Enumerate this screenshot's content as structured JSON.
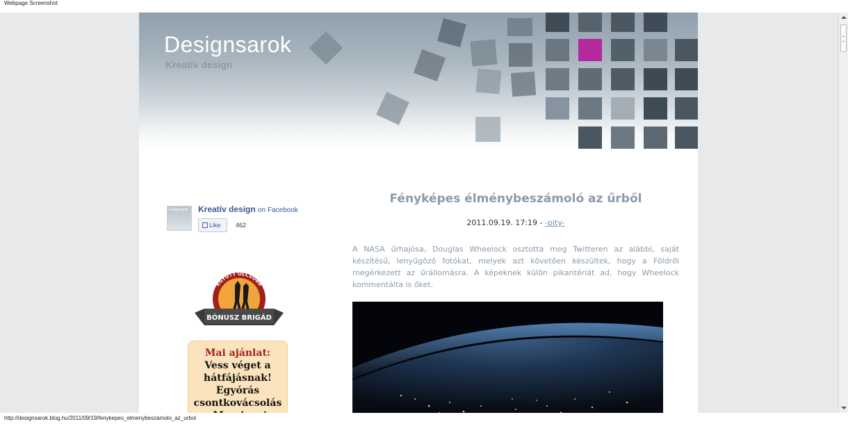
{
  "window": {
    "title": "Webpage Screenshot"
  },
  "status_bar": {
    "url": "http://designsarok.blog.hu/2011/09/19/fenykepes_elmenybeszamolo_az_urbol"
  },
  "header": {
    "site_title": "Designsarok",
    "tagline": "Kreatív design",
    "accent_color": "#b5299f"
  },
  "facebook": {
    "page_name": "Kreatív design",
    "suffix": "on Facebook",
    "like_label": "Like",
    "like_count": "462"
  },
  "badge": {
    "arc_text": "EGYÜTT OLCSÓBB",
    "ribbon_text": "BÓNUSZ BRIGÁD"
  },
  "offer": {
    "label": "Mai ajánlat:",
    "text": "Vess véget a hátfájásnak! Egyórás csontkovácsolás a Morrison’s"
  },
  "post": {
    "title": "Fényképes élménybeszámoló az űrből",
    "datetime": "2011.09.19. 17:19",
    "separator": " - ",
    "author": "-pity-",
    "body": "A NASA űrhajósa, Douglas Wheelock osztotta meg Twitteren az alábbi, saját készítésű, lenyűgöző fotókat, melyek azt követően készültek, hogy a Földről megérkezett az űrállomásra. A képeknek külön pikantériát ad, hogy Wheelock kommentálta is őket."
  }
}
